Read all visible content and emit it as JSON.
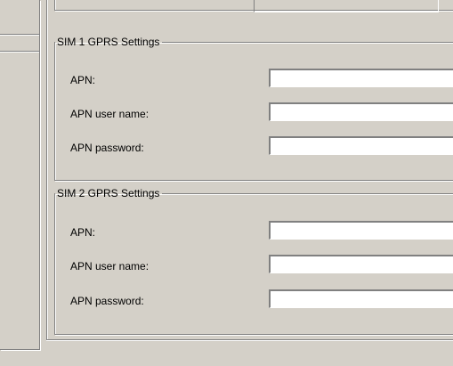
{
  "sim1": {
    "title": "SIM 1 GPRS Settings",
    "apn_label": "APN:",
    "apn_value": "",
    "user_label": "APN user name:",
    "user_value": "",
    "password_label": "APN password:",
    "password_value": ""
  },
  "sim2": {
    "title": "SIM 2 GPRS Settings",
    "apn_label": "APN:",
    "apn_value": "",
    "user_label": "APN user name:",
    "user_value": "",
    "password_label": "APN password:",
    "password_value": ""
  },
  "colors": {
    "background": "#d4d0c8",
    "shadow": "#808080",
    "highlight": "#ffffff",
    "input_background": "#ffffff"
  }
}
